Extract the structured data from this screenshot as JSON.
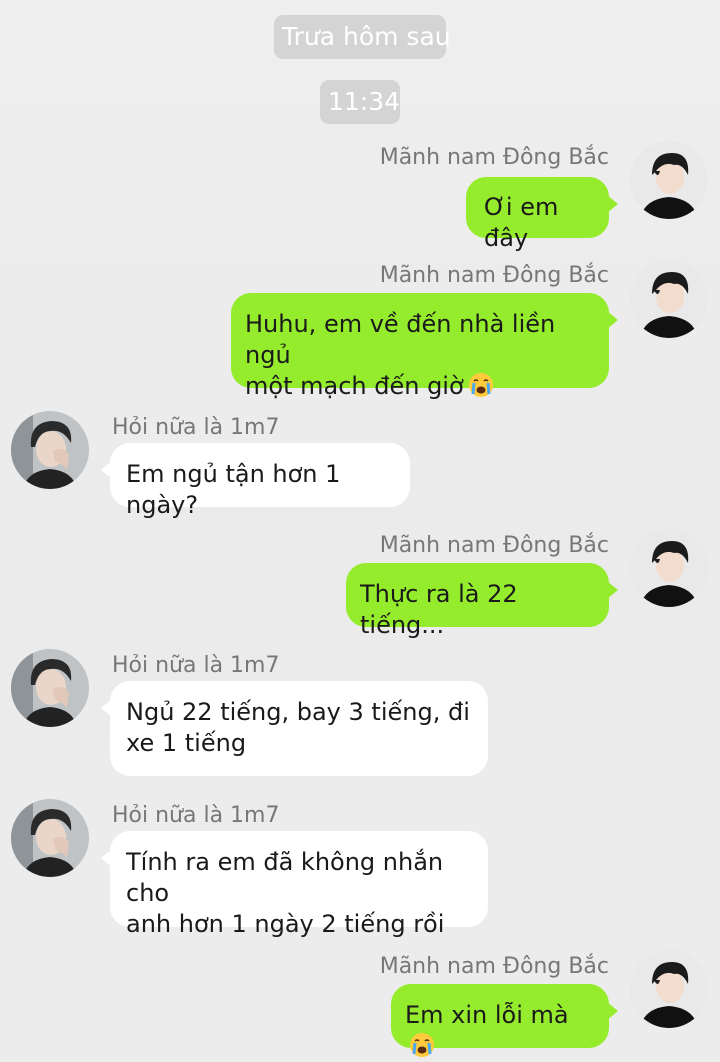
{
  "dividers": {
    "date_label": "Trưa hôm sau",
    "time_label": "11:34"
  },
  "contacts": {
    "me": {
      "name": "Mãnh nam Đông Bắc",
      "avatar": "avatar-man-black-hair"
    },
    "other": {
      "name": "Hỏi nữa là 1m7",
      "avatar": "avatar-man-hand-on-face"
    }
  },
  "messages": [
    {
      "from": "me",
      "sender": "Mãnh nam Đông Bắc",
      "text": "Ơi em đây"
    },
    {
      "from": "me",
      "sender": "Mãnh nam Đông Bắc",
      "text": "Huhu, em về đến nhà liền ngủ\nmột mạch đến giờ",
      "emoji": "crying-face-emoji"
    },
    {
      "from": "other",
      "sender": "Hỏi nữa là 1m7",
      "text": "Em ngủ tận hơn 1 ngày?"
    },
    {
      "from": "me",
      "sender": "Mãnh nam Đông Bắc",
      "text": "Thực ra là 22 tiếng..."
    },
    {
      "from": "other",
      "sender": "Hỏi nữa là 1m7",
      "text": "Ngủ 22 tiếng, bay 3 tiếng, đi\nxe 1 tiếng"
    },
    {
      "from": "other",
      "sender": "Hỏi nữa là 1m7",
      "text": "Tính ra em đã không nhắn cho\nanh hơn 1 ngày 2 tiếng rồi"
    },
    {
      "from": "me",
      "sender": "Mãnh nam Đông Bắc",
      "text": "Em xin lỗi mà",
      "emoji": "crying-face-emoji"
    }
  ],
  "colors": {
    "background": "#ececec",
    "outgoing_bubble": "#95ec2c",
    "incoming_bubble": "#ffffff",
    "divider_pill": "#d4d4d4",
    "sender_name": "#777777"
  }
}
